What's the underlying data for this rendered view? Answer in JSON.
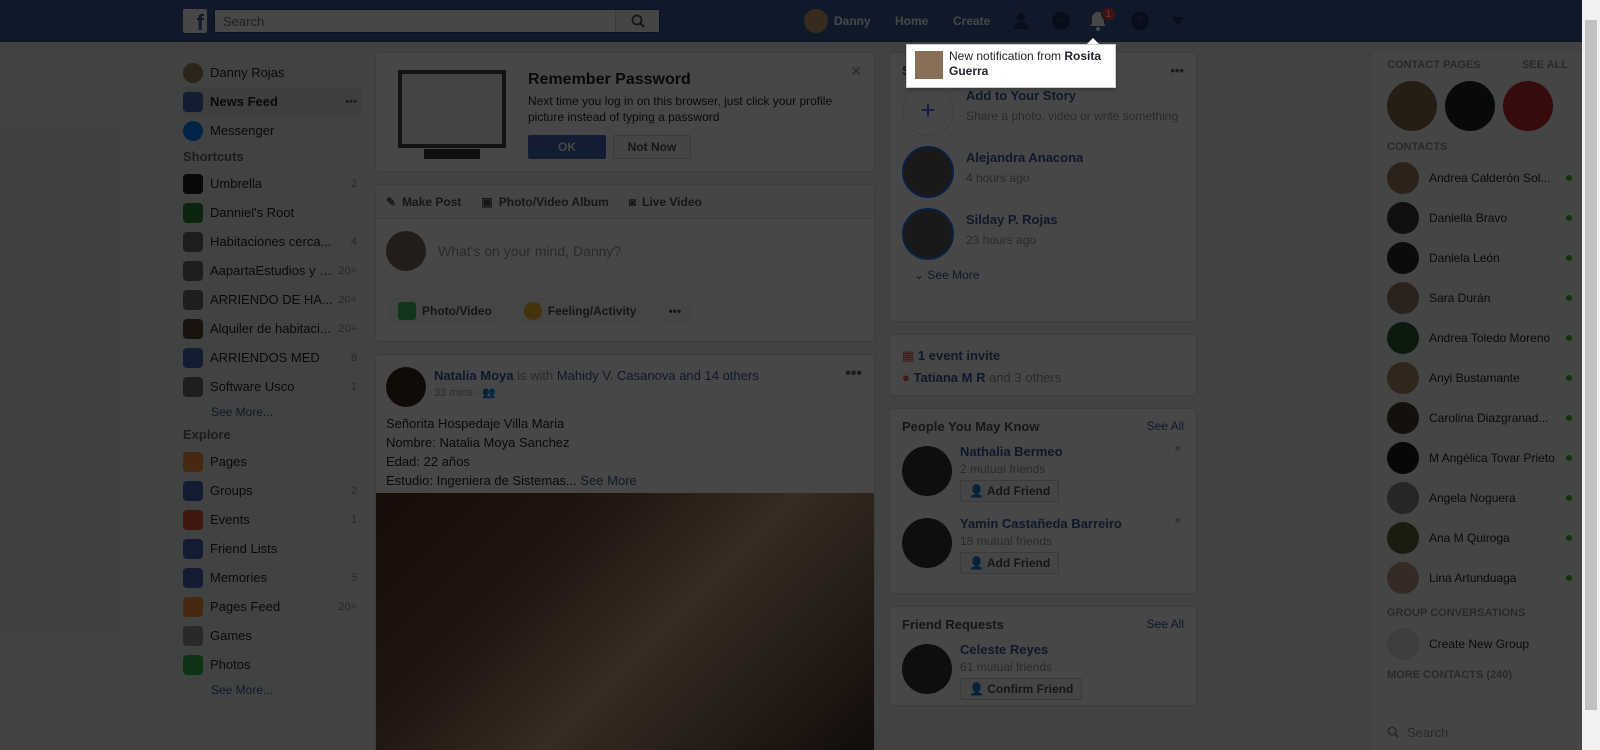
{
  "topbar": {
    "logo": "f",
    "search_placeholder": "Search",
    "user_name": "Danny",
    "home": "Home",
    "create": "Create",
    "notif_count": "1"
  },
  "notification": {
    "prefix": "New notification from ",
    "from": "Rosita Guerra"
  },
  "left": {
    "profile": "Danny Rojas",
    "news_feed": "News Feed",
    "messenger": "Messenger",
    "shortcuts_title": "Shortcuts",
    "shortcuts": [
      {
        "label": "Umbrella",
        "count": "2",
        "color": "#222"
      },
      {
        "label": "Danniel's Root",
        "count": "",
        "color": "#2e7d32"
      },
      {
        "label": "Habitaciones cerca...",
        "count": "4",
        "color": "#6d6d6d"
      },
      {
        "label": "AapartaEstudios y H...",
        "count": "20+",
        "color": "#6d6d6d"
      },
      {
        "label": "ARRIENDO DE HA...",
        "count": "20+",
        "color": "#6d6d6d"
      },
      {
        "label": "Alquiler de habitaci...",
        "count": "20+",
        "color": "#5d4037"
      },
      {
        "label": "ARRIENDOS MED",
        "count": "8",
        "color": "#4267b2"
      },
      {
        "label": "Software Usco",
        "count": "1",
        "color": "#6d6d6d"
      }
    ],
    "see_more_1": "See More...",
    "explore_title": "Explore",
    "explore": [
      {
        "label": "Pages",
        "count": "",
        "color": "#f7923b"
      },
      {
        "label": "Groups",
        "count": "2",
        "color": "#4267b2"
      },
      {
        "label": "Events",
        "count": "1",
        "color": "#e9573f"
      },
      {
        "label": "Friend Lists",
        "count": "",
        "color": "#4267b2"
      },
      {
        "label": "Memories",
        "count": "5",
        "color": "#4267b2"
      },
      {
        "label": "Pages Feed",
        "count": "20+",
        "color": "#f7923b"
      },
      {
        "label": "Games",
        "count": "",
        "color": "#90949c"
      },
      {
        "label": "Photos",
        "count": "",
        "color": "#3ab54a"
      }
    ],
    "see_more_2": "See More..."
  },
  "remember": {
    "title": "Remember Password",
    "text": "Next time you log in on this browser, just click your profile picture instead of typing a password",
    "ok": "OK",
    "not_now": "Not Now"
  },
  "composer": {
    "tab_post": "Make Post",
    "tab_album": "Photo/Video Album",
    "tab_live": "Live Video",
    "placeholder": "What's on your mind, Danny?",
    "btn_photo": "Photo/Video",
    "btn_feeling": "Feeling/Activity",
    "btn_more": "•••"
  },
  "post": {
    "author": "Natalia Moya",
    "with_text": " is with ",
    "with_name": "Mahidy V. Casanova",
    "and_others": " and 14 others",
    "time": "33 mins ·",
    "line1": "Señorita Hospedaje Villa Maria",
    "line2": "Nombre: Natalia Moya Sanchez",
    "line3": "Edad: 22 años",
    "line4": "Estudio: Ingeniera de Sistemas...",
    "see_more": "See More"
  },
  "stories": {
    "title": "S",
    "add_title": "Add to Your Story",
    "add_sub": "Share a photo, video or write something",
    "items": [
      {
        "name": "Alejandra Anacona",
        "time": "4 hours ago"
      },
      {
        "name": "Silday P. Rojas",
        "time": "23 hours ago"
      }
    ],
    "see_more": "See More"
  },
  "events": {
    "invite": "1 event invite",
    "name": "Tatiana M R",
    "others": " and 3 others"
  },
  "pymk": {
    "title": "People You May Know",
    "see_all": "See All",
    "items": [
      {
        "name": "Nathalia Bermeo",
        "mutual": "2 mutual friends",
        "btn": "Add Friend"
      },
      {
        "name": "Yamin Castañeda Barreiro",
        "mutual": "18 mutual friends",
        "btn": "Add Friend"
      }
    ]
  },
  "requests": {
    "title": "Friend Requests",
    "see_all": "See All",
    "name": "Celeste Reyes",
    "mutual": "61 mutual friends",
    "btn": "Confirm Friend"
  },
  "chat": {
    "contact_pages": "CONTACT PAGES",
    "see_all": "SEE ALL",
    "contacts_title": "CONTACTS",
    "contacts": [
      "Andrea Calderón Sol...",
      "Daniella Bravo",
      "Daniela León",
      "Sara Durán",
      "Andrea Toledo Moreno",
      "Anyi Bustamante",
      "Carolina Diazgranad...",
      "M Angélica Tovar Prieto",
      "Angela Noguera",
      "Ana M Quiroga",
      "Lina Artunduaga"
    ],
    "group_title": "GROUP CONVERSATIONS",
    "create_group": "Create New Group",
    "more_contacts": "MORE CONTACTS (240)",
    "search": "Search"
  }
}
